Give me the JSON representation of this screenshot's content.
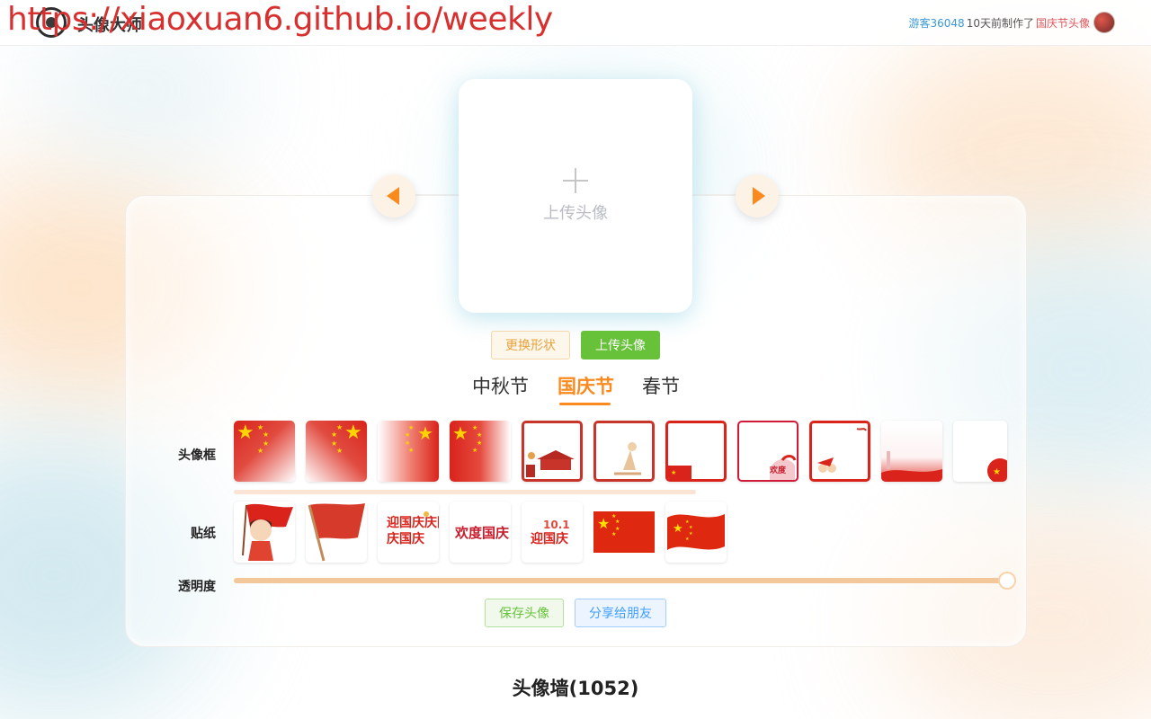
{
  "overlay_url": "https://xiaoxuan6.github.io/weekly",
  "header": {
    "brand": "头像大师",
    "recent": {
      "guest": "游客36048",
      "made": "10天前制作了",
      "item": "国庆节头像"
    }
  },
  "preview": {
    "upload_hint": "上传头像"
  },
  "buttons": {
    "change_shape": "更换形状",
    "upload": "上传头像",
    "save": "保存头像",
    "share": "分享给朋友"
  },
  "tabs": [
    {
      "label": "中秋节",
      "active": false
    },
    {
      "label": "国庆节",
      "active": true
    },
    {
      "label": "春节",
      "active": false
    }
  ],
  "labels": {
    "frames": "头像框",
    "stickers": "贴纸",
    "opacity": "透明度"
  },
  "opacity": {
    "value": 100,
    "max": 100
  },
  "avatar_wall": {
    "title": "头像墙(1052)"
  },
  "colors": {
    "accent": "#fb8a1e",
    "upload_green": "#67c23a",
    "flag_red": "#de2910",
    "star_yellow": "#ffde00"
  },
  "stickers": [
    {
      "icon": "girl-with-flag-icon"
    },
    {
      "icon": "red-flag-icon"
    },
    {
      "icon": "celebrate-national-day-icon"
    },
    {
      "icon": "happy-national-day-icon"
    },
    {
      "icon": "national-day-101-icon"
    },
    {
      "icon": "china-flag-icon"
    },
    {
      "icon": "waving-china-flag-icon"
    }
  ],
  "sticker_texts": {
    "s3": "迎国庆庆国庆",
    "s4": "欢度国庆",
    "s5": "10.1 迎国庆"
  }
}
